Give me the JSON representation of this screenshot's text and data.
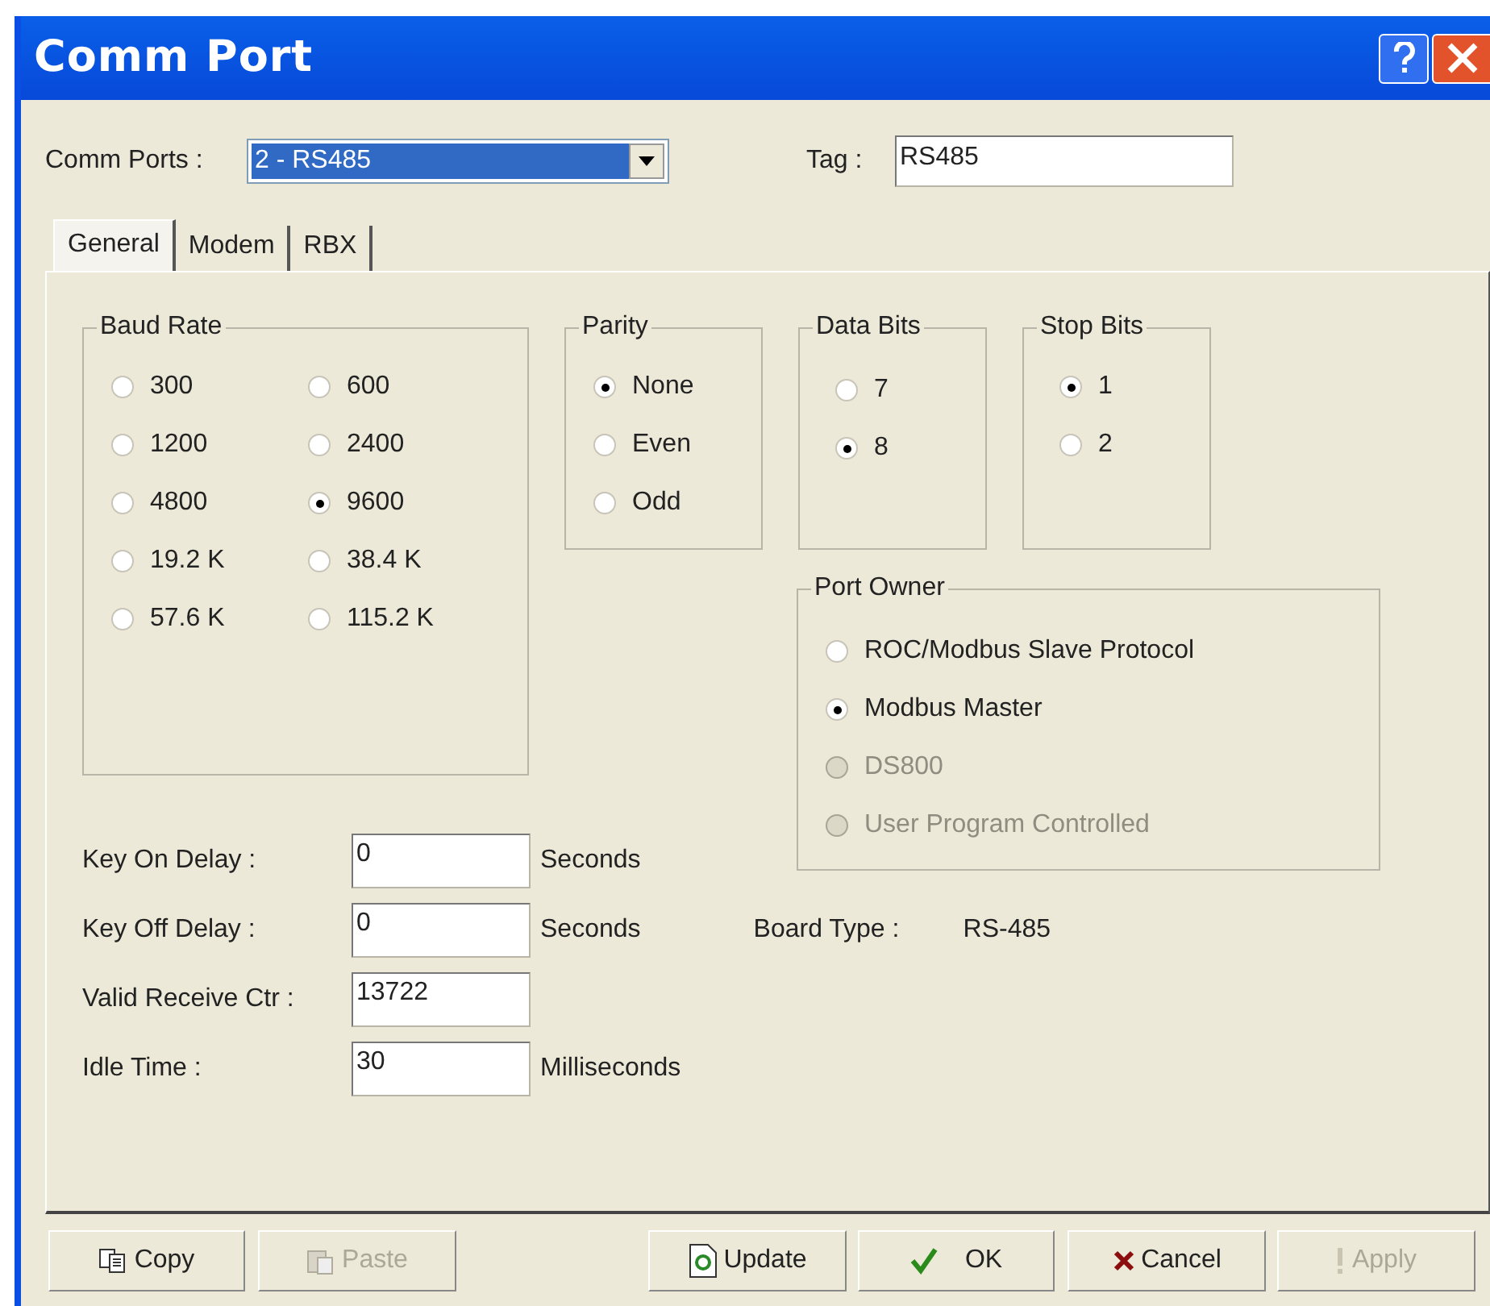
{
  "window": {
    "title": "Comm Port"
  },
  "comm_ports": {
    "label": "Comm Ports :",
    "value": "2 - RS485"
  },
  "tag": {
    "label": "Tag :",
    "value": "RS485"
  },
  "tabs": [
    {
      "label": "General",
      "selected": true
    },
    {
      "label": "Modem",
      "selected": false
    },
    {
      "label": "RBX",
      "selected": false
    }
  ],
  "baud_rate": {
    "title": "Baud Rate",
    "options": [
      {
        "label": "300",
        "selected": false
      },
      {
        "label": "600",
        "selected": false
      },
      {
        "label": "1200",
        "selected": false
      },
      {
        "label": "2400",
        "selected": false
      },
      {
        "label": "4800",
        "selected": false
      },
      {
        "label": "9600",
        "selected": true
      },
      {
        "label": "19.2 K",
        "selected": false
      },
      {
        "label": "38.4 K",
        "selected": false
      },
      {
        "label": "57.6 K",
        "selected": false
      },
      {
        "label": "115.2 K",
        "selected": false
      }
    ]
  },
  "parity": {
    "title": "Parity",
    "options": [
      {
        "label": "None",
        "selected": true
      },
      {
        "label": "Even",
        "selected": false
      },
      {
        "label": "Odd",
        "selected": false
      }
    ]
  },
  "data_bits": {
    "title": "Data Bits",
    "options": [
      {
        "label": "7",
        "selected": false
      },
      {
        "label": "8",
        "selected": true
      }
    ]
  },
  "stop_bits": {
    "title": "Stop Bits",
    "options": [
      {
        "label": "1",
        "selected": true
      },
      {
        "label": "2",
        "selected": false
      }
    ]
  },
  "port_owner": {
    "title": "Port Owner",
    "options": [
      {
        "label": "ROC/Modbus Slave Protocol",
        "selected": false,
        "disabled": false
      },
      {
        "label": "Modbus Master",
        "selected": true,
        "disabled": false
      },
      {
        "label": "DS800",
        "selected": false,
        "disabled": true
      },
      {
        "label": "User Program Controlled",
        "selected": false,
        "disabled": true
      }
    ]
  },
  "fields": [
    {
      "label": "Key On Delay :",
      "value": "0",
      "unit": "Seconds"
    },
    {
      "label": "Key Off Delay :",
      "value": "0",
      "unit": "Seconds"
    },
    {
      "label": "Valid Receive Ctr :",
      "value": "13722"
    },
    {
      "label": "Idle Time :",
      "value": "30",
      "unit": "Milliseconds"
    }
  ],
  "board_type": {
    "label": "Board Type :",
    "value": "RS-485"
  },
  "buttons": [
    {
      "label": "Copy",
      "kind": "copy",
      "disabled": false
    },
    {
      "label": "Paste",
      "kind": "paste",
      "disabled": true
    },
    {
      "label": "Update",
      "kind": "update",
      "disabled": false
    },
    {
      "label": "OK",
      "kind": "ok",
      "disabled": false
    },
    {
      "label": "Cancel",
      "kind": "cancel",
      "disabled": false
    },
    {
      "label": "Apply",
      "kind": "apply",
      "disabled": true
    }
  ]
}
